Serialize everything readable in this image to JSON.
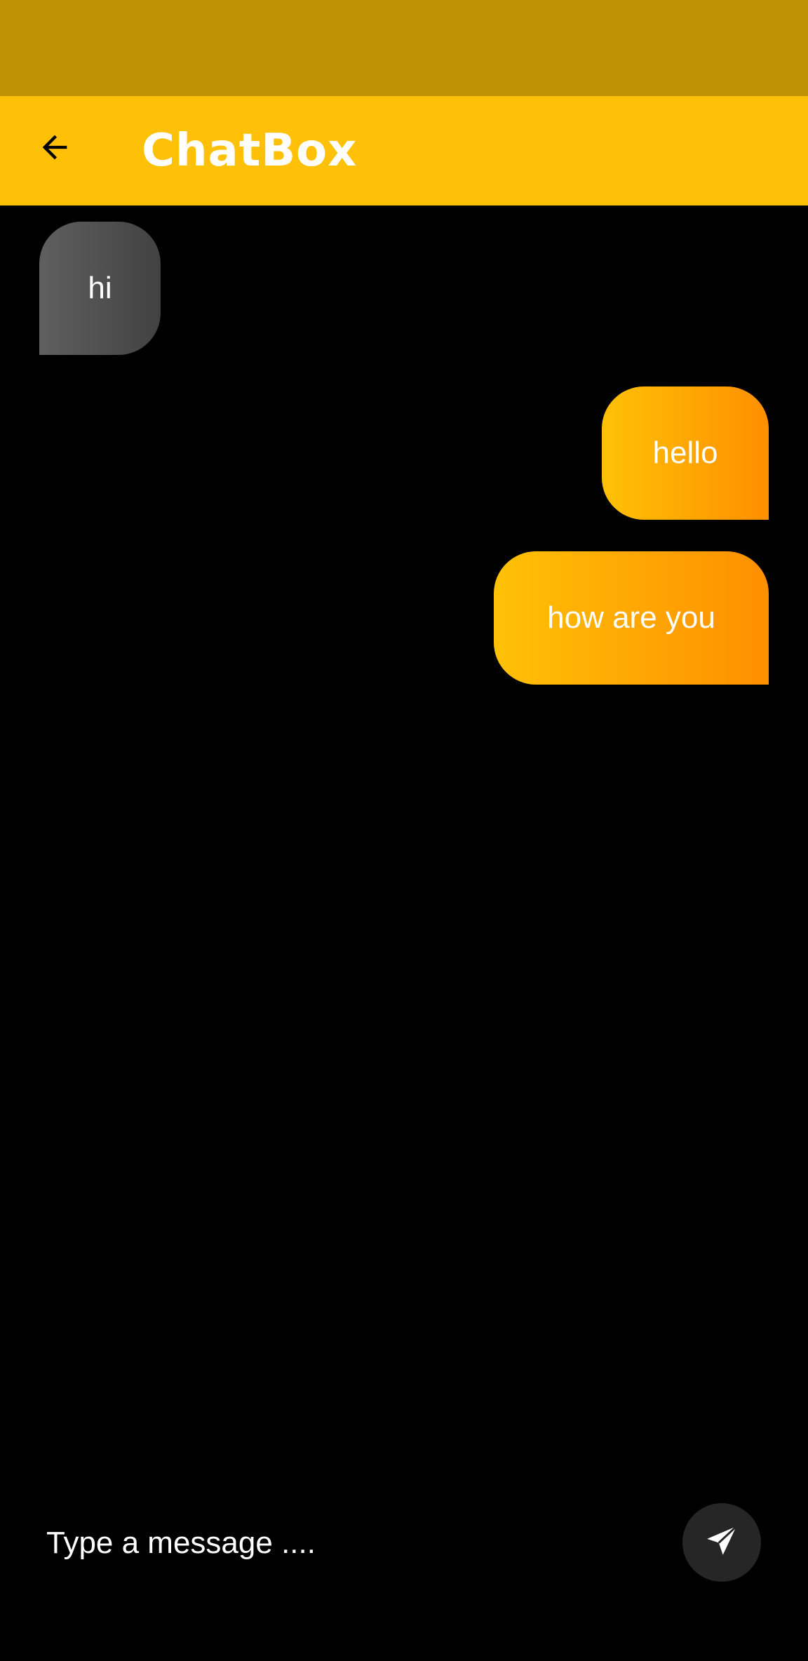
{
  "app_bar": {
    "title": "ChatBox",
    "back_icon": "arrow-back-icon"
  },
  "messages": [
    {
      "text": "hi",
      "direction": "received"
    },
    {
      "text": "hello",
      "direction": "sent"
    },
    {
      "text": "how are you",
      "direction": "sent"
    }
  ],
  "composer": {
    "placeholder": "Type a message ....",
    "value": "",
    "send_icon": "send-icon"
  },
  "colors": {
    "status_bar": "#BF9104",
    "app_bar": "#FFC107",
    "background": "#000000",
    "sent_gradient_start": "#FFC107",
    "sent_gradient_end": "#FF8F00",
    "received_gradient_start": "#5F5F5F",
    "received_gradient_end": "#424242",
    "send_button": "#262626"
  }
}
